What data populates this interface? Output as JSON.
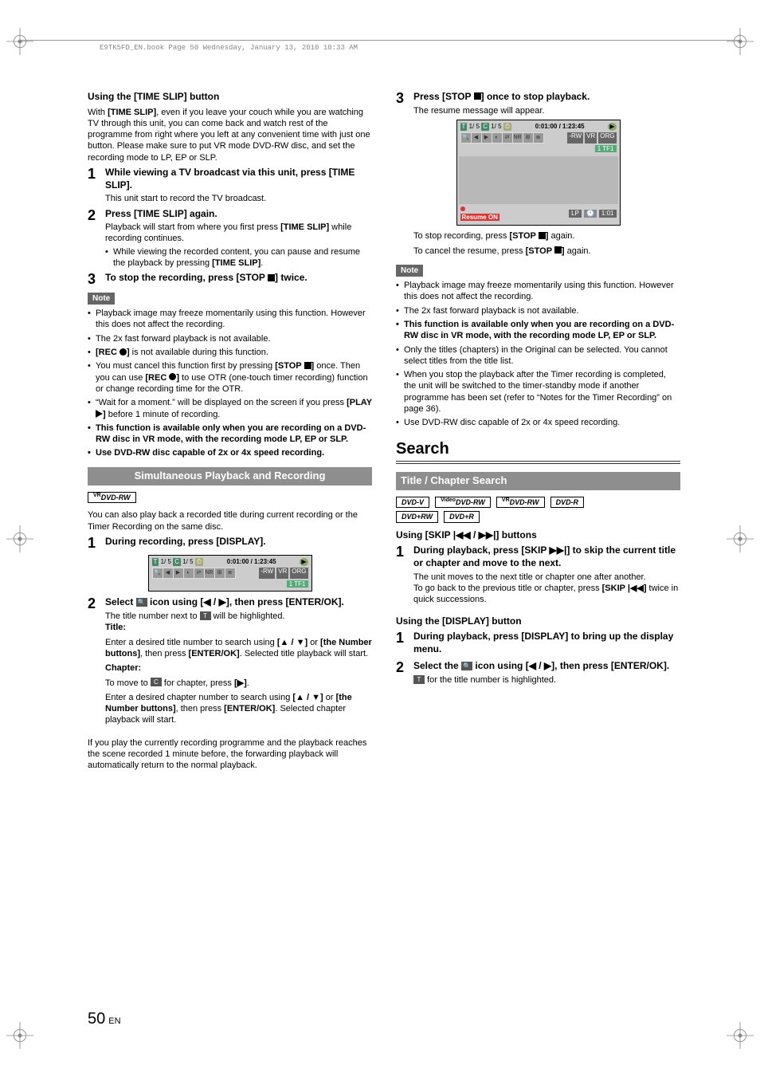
{
  "header_bar": "E9TK5FD_EN.book  Page 50  Wednesday, January 13, 2010  10:33 AM",
  "page_number": "50",
  "page_lang": "EN",
  "left": {
    "h1": "Using the [TIME SLIP] button",
    "intro": "With [TIME SLIP], even if you leave your couch while you are watching TV through this unit, you can come back and watch rest of the programme from right where you left at any convenient time with just one button. Please make sure to put VR mode DVD-RW disc, and set the recording mode to LP, EP or SLP.",
    "s1_t": "While viewing a TV broadcast via this unit, press [TIME SLIP].",
    "s1_b": "This unit start to record the TV broadcast.",
    "s2_t": "Press [TIME SLIP] again.",
    "s2_b": "Playback will start from where you first press [TIME SLIP] while recording continues.",
    "s2_bul": "While viewing the recorded content, you can pause and resume the playback by pressing [TIME SLIP].",
    "s3_t": "To stop the recording, press [STOP ■] twice.",
    "note_label": "Note",
    "n1": "Playback image may freeze momentarily using this function. However this does not affect the recording.",
    "n2": "The 2x fast forward playback is not available.",
    "n3": "[REC ●] is not available during this function.",
    "n4": "You must cancel this function first by pressing [STOP ■] once. Then you can use [REC ●] to use OTR (one-touch timer recording) function or change recording time for the OTR.",
    "n5": "“Wait for a moment.” will be displayed on the screen if you press [PLAY ▶] before 1 minute of recording.",
    "n6": "This function is available only when you are recording on a DVD-RW disc in VR mode, with the recording mode LP, EP or SLP.",
    "n7": "Use DVD-RW disc capable of 2x or 4x speed recording.",
    "band": "Simultaneous Playback and Recording",
    "disc": "DVD-RW",
    "disc_sup": "VR",
    "band_intro": "You can also play back a recorded title during current recording or the Timer Recording on the same disc.",
    "spr_s1_t": "During recording, press [DISPLAY].",
    "osd1": {
      "t": "1/  5",
      "c": "1/  5",
      "time": "0:01:00 / 1:23:45",
      "tags": [
        "-RW",
        "VR",
        "ORG"
      ],
      "tf": "1   TF1"
    },
    "spr_s2_t": "Select  icon using [◀ / ▶], then press [ENTER/OK].",
    "spr_s2_b1": "The title number next to  will be highlighted.",
    "spr_s2_title_head": "Title:",
    "spr_s2_title_body": "Enter a desired title number to search using [▲ / ▼] or [the Number buttons], then press [ENTER/OK]. Selected title playback will start.",
    "spr_s2_ch_head": "Chapter:",
    "spr_s2_ch_b1": "To move to  for chapter, press [▶].",
    "spr_s2_ch_b2": "Enter a desired chapter number to search using [▲ / ▼] or [the Number buttons], then press [ENTER/OK]. Selected chapter playback will start.",
    "left_footer": "If you play the currently recording programme and the playback reaches the scene recorded 1 minute before, the forwarding playback will automatically return to the normal playback."
  },
  "right": {
    "s3_t": "Press [STOP ■] once to stop playback.",
    "s3_b": "The resume message will appear.",
    "osd2": {
      "t": "1/  5",
      "c": "1/  5",
      "time": "0:01:00 / 1:23:45",
      "tags": [
        "-RW",
        "VR",
        "ORG"
      ],
      "tf": "1   TF1",
      "resume": "Resume ON",
      "lp": "LP",
      "clock": "1:01"
    },
    "s3_sub1": "To stop recording, press [STOP ■] again.",
    "s3_sub2": "To cancel the resume, press [STOP ■] again.",
    "note_label": "Note",
    "n1": "Playback image may freeze momentarily using this function. However this does not affect the recording.",
    "n2": "The 2x fast forward playback is not available.",
    "n3": "This function is available only when you are recording on a DVD-RW disc in VR mode, with the recording mode LP, EP or SLP.",
    "n4": "Only the titles (chapters) in the Original can be selected. You cannot select titles from the title list.",
    "n5": "When you stop the playback after the Timer recording is completed, the unit will be switched to the timer-standby mode if another programme has been set (refer to “Notes for the Timer Recording” on page 36).",
    "n6": "Use DVD-RW disc capable of 2x or 4x speed recording.",
    "big": "Search",
    "band": "Title / Chapter Search",
    "discs": [
      "DVD-V",
      "DVD-RW|Video",
      "DVD-RW|VR",
      "DVD-R",
      "DVD+RW",
      "DVD+R"
    ],
    "skip_head": "Using [SKIP |◀◀ / ▶▶|] buttons",
    "skip_s1_t": "During playback, press [SKIP ▶▶|] to skip the current title or chapter and move to the next.",
    "skip_s1_b1": "The unit moves to the next title or chapter one after another.",
    "skip_s1_b2": "To go back to the previous title or chapter, press [SKIP |◀◀] twice in quick successions.",
    "disp_head": "Using the [DISPLAY] button",
    "disp_s1_t": "During playback, press [DISPLAY] to bring up the display menu.",
    "disp_s2_t": "Select the  icon using [◀ / ▶], then press [ENTER/OK].",
    "disp_s2_b": " for the title number is highlighted."
  }
}
